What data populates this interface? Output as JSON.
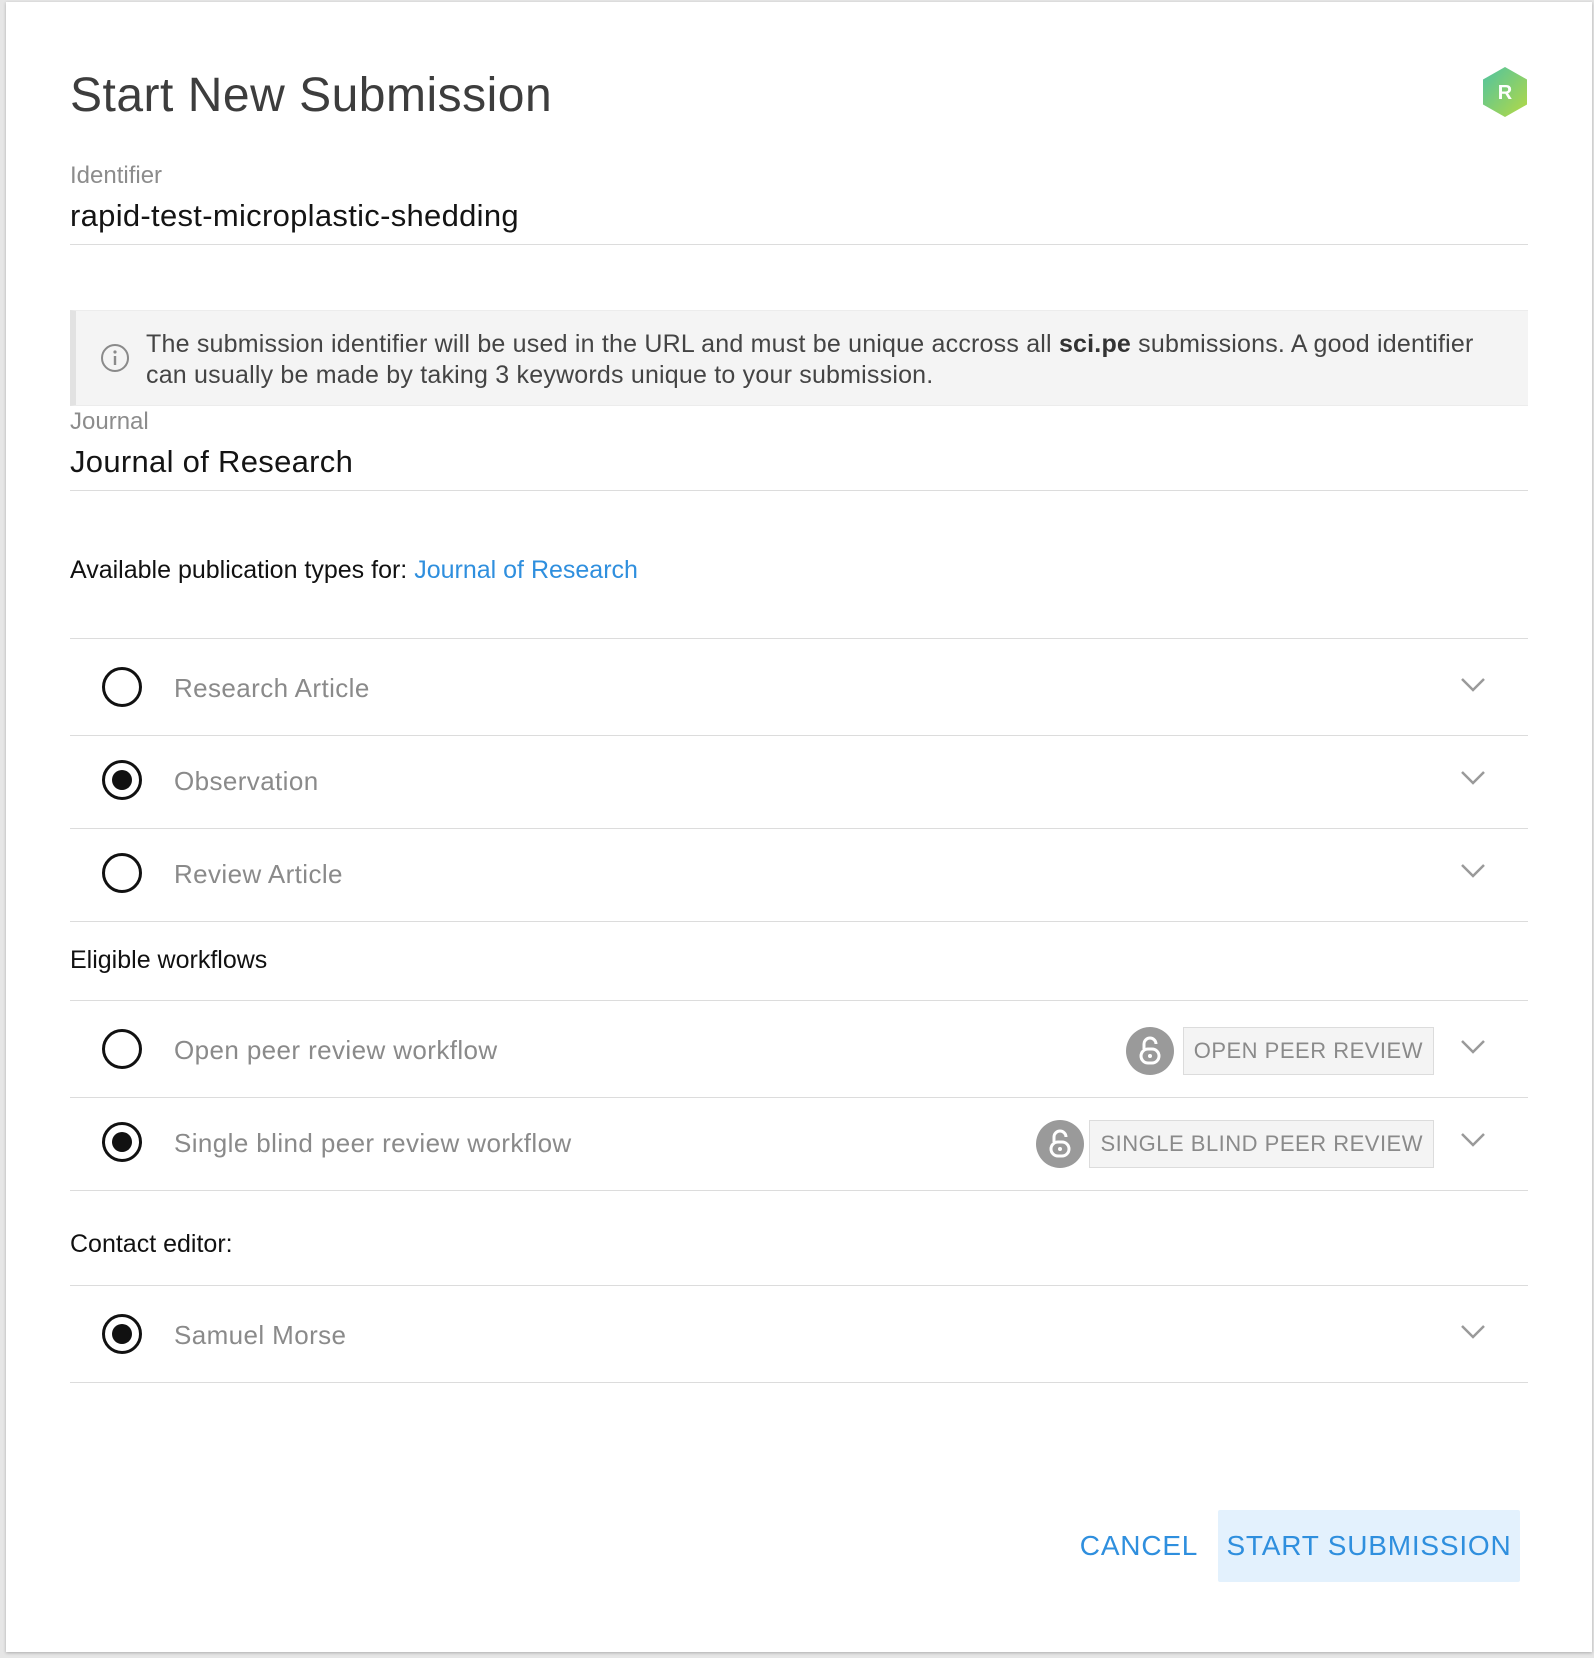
{
  "dialog": {
    "title": "Start New Submission",
    "badge_letter": "R"
  },
  "identifier": {
    "label": "Identifier",
    "value": "rapid-test-microplastic-shedding"
  },
  "info": {
    "text_before": "The submission identifier will be used in the URL and must be unique accross all ",
    "text_bold": "sci.pe",
    "text_after": " submissions. A good identifier can usually be made by taking 3 keywords unique to your submission."
  },
  "journal": {
    "label": "Journal",
    "value": "Journal of Research"
  },
  "publication_types": {
    "heading": "Available publication types for: ",
    "journal_link": "Journal of Research",
    "items": [
      {
        "label": "Research Article",
        "selected": false
      },
      {
        "label": "Observation",
        "selected": true
      },
      {
        "label": "Review Article",
        "selected": false
      }
    ]
  },
  "workflows": {
    "heading": "Eligible workflows",
    "items": [
      {
        "label": "Open peer review workflow",
        "tag": "OPEN PEER REVIEW",
        "selected": false,
        "icon": "unlock-icon"
      },
      {
        "label": "Single blind peer review workflow",
        "tag": "SINGLE BLIND PEER REVIEW",
        "selected": true,
        "icon": "unlock-icon"
      }
    ]
  },
  "contact": {
    "heading": "Contact editor:",
    "items": [
      {
        "label": "Samuel Morse",
        "selected": true
      }
    ]
  },
  "actions": {
    "cancel": "CANCEL",
    "start": "START SUBMISSION"
  },
  "colors": {
    "accent": "#2f8fde",
    "button_bg": "#e3f1fd",
    "badge_green": "#7dc86b"
  }
}
